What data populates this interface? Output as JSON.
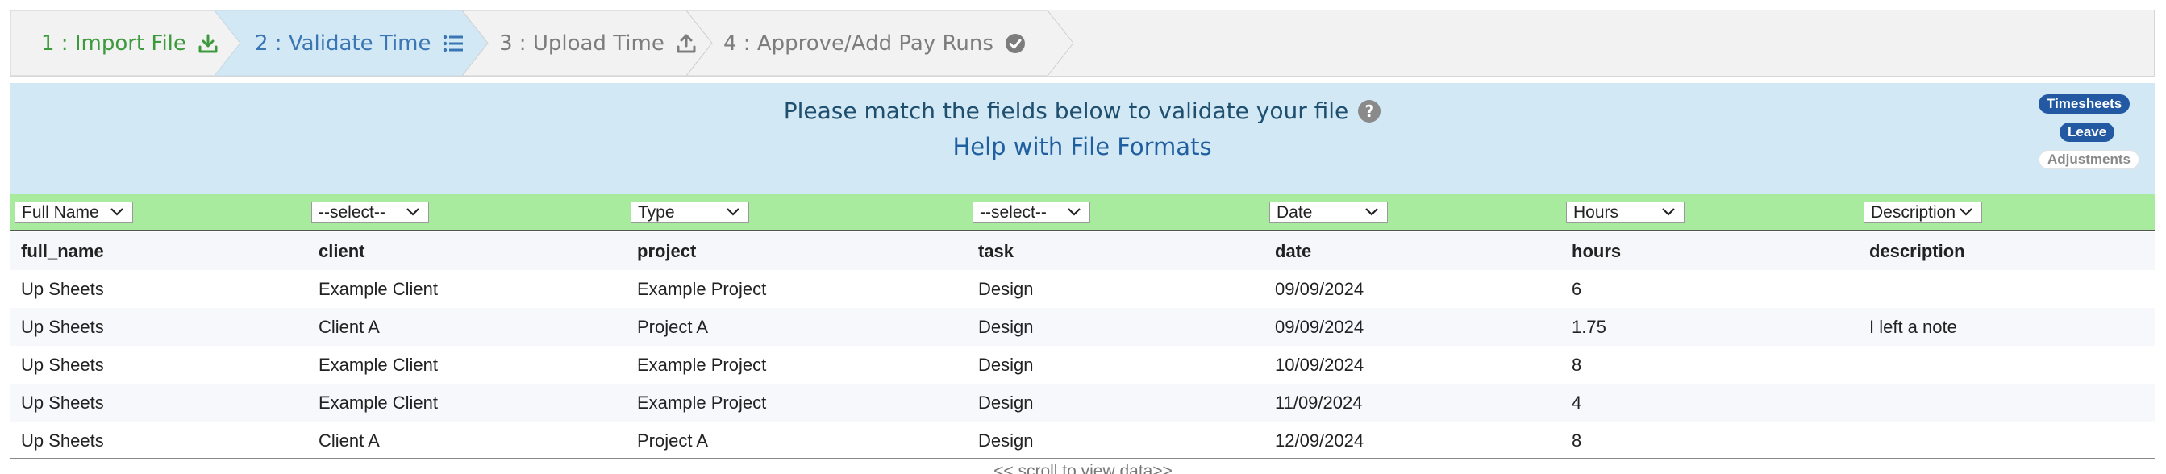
{
  "wizard": {
    "steps": [
      {
        "label": "1 : Import File",
        "icon": "download-icon",
        "state": "done"
      },
      {
        "label": "2 : Validate Time",
        "icon": "list-icon",
        "state": "active"
      },
      {
        "label": "3 : Upload Time",
        "icon": "upload-icon",
        "state": "pending"
      },
      {
        "label": "4 : Approve/Add Pay Runs",
        "icon": "check-circle-icon",
        "state": "pending"
      }
    ]
  },
  "banner": {
    "title": "Please match the fields below to validate your file",
    "help_icon": "?",
    "link": "Help with File Formats",
    "pills": [
      {
        "label": "Timesheets",
        "active": true
      },
      {
        "label": "Leave",
        "active": true
      },
      {
        "label": "Adjustments",
        "active": false
      }
    ]
  },
  "mapping": {
    "selects": [
      "Full Name",
      "--select--",
      "Type",
      "--select--",
      "Date",
      "Hours",
      "Description"
    ]
  },
  "table": {
    "columns": [
      "full_name",
      "client",
      "project",
      "task",
      "date",
      "hours",
      "description"
    ],
    "rows": [
      [
        "Up Sheets",
        "Example Client",
        "Example Project",
        "Design",
        "09/09/2024",
        "6",
        ""
      ],
      [
        "Up Sheets",
        "Client A",
        "Project A",
        "Design",
        "09/09/2024",
        "1.75",
        "I left a note"
      ],
      [
        "Up Sheets",
        "Example Client",
        "Example Project",
        "Design",
        "10/09/2024",
        "8",
        ""
      ],
      [
        "Up Sheets",
        "Example Client",
        "Example Project",
        "Design",
        "11/09/2024",
        "4",
        ""
      ],
      [
        "Up Sheets",
        "Client A",
        "Project A",
        "Design",
        "12/09/2024",
        "8",
        ""
      ]
    ]
  },
  "scroll_hint": "<< scroll to view data>>",
  "colors": {
    "done": "#3c9a3c",
    "active": "#3a76b3",
    "pending": "#7d7d7d",
    "banner_bg": "#d3e8f5",
    "mapping_bg": "#a8ea9e",
    "pill_on": "#2359a3"
  }
}
